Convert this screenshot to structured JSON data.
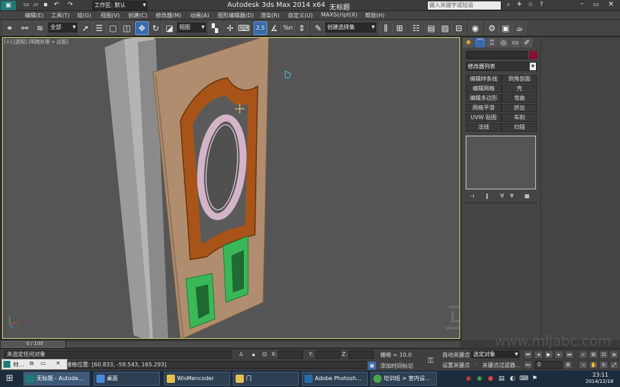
{
  "titlebar": {
    "workspace_label": "工作区: 默认",
    "app_title": "Autodesk 3ds Max 2014 x64",
    "doc_title": "无标题",
    "search_placeholder": "键入关键字或短语"
  },
  "menu": [
    "编辑(E)",
    "工具(T)",
    "组(G)",
    "视图(V)",
    "创建(C)",
    "修改器(M)",
    "动画(A)",
    "图形编辑器(D)",
    "渲染(R)",
    "自定义(U)",
    "MAXScript(X)",
    "帮助(H)"
  ],
  "toolbar": {
    "filter_select": "全部",
    "ref_coord_select": "视图",
    "selection_set_select": "创建选择集",
    "snap_label": "2.5",
    "angle_snap_label": "%",
    "percent_snap_label": "%n"
  },
  "viewport": {
    "label": "[+] [透视] [明暗处理 + 边面]"
  },
  "command_panel": {
    "modifier_list": "修改器列表",
    "buttons": [
      [
        "编辑样条线",
        "倒角剖面"
      ],
      [
        "编辑网格",
        "壳"
      ],
      [
        "编辑多边形",
        "弯曲"
      ],
      [
        "网格平滑",
        "挤出"
      ],
      [
        "UVW 贴图",
        "车削"
      ],
      [
        "法线",
        "扫描"
      ]
    ],
    "accent_color": "#8a1030"
  },
  "timeline": {
    "frame": "0 / 100"
  },
  "status": {
    "prompt1": "未选定任何对象",
    "prompt2": "栅格位置: [60.833, -59.543, 165.293]",
    "x_label": "X:",
    "y_label": "Y:",
    "z_label": "Z:",
    "grid": "栅格 = 10.0",
    "add_time_tag": "添加时间标记",
    "autokey": "自动关键点",
    "setkey": "设置关键点",
    "selected_object": "选定对象",
    "key_filter": "关键点过滤器...",
    "frame_field": "0",
    "mini_panel_label": "材...",
    "watermark": "马良中国",
    "watermark_url": "www.mljabc.com"
  },
  "taskbar": {
    "items": [
      "无标题 - Autode...",
      "桌面",
      "WisMencoder",
      "门",
      "Adobe Photosh...",
      "培训班 > 室内设..."
    ],
    "clock_time": "23:11",
    "clock_date": "2014/12/18"
  }
}
